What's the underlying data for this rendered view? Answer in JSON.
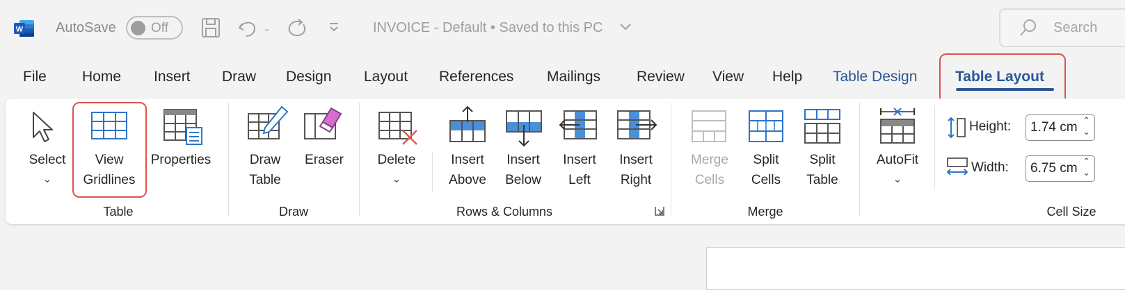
{
  "title_bar": {
    "autosave_label": "AutoSave",
    "autosave_state": "Off",
    "doc_title": "INVOICE - Default • Saved to this PC",
    "search_placeholder": "Search"
  },
  "tabs": [
    "File",
    "Home",
    "Insert",
    "Draw",
    "Design",
    "Layout",
    "References",
    "Mailings",
    "Review",
    "View",
    "Help",
    "Table Design",
    "Table Layout"
  ],
  "active_tab": "Table Layout",
  "ribbon": {
    "groups": {
      "table": "Table",
      "draw": "Draw",
      "rows_columns": "Rows & Columns",
      "merge": "Merge",
      "cell_size": "Cell Size"
    },
    "buttons": {
      "select": "Select",
      "view_gridlines_1": "View",
      "view_gridlines_2": "Gridlines",
      "properties": "Properties",
      "draw_table_1": "Draw",
      "draw_table_2": "Table",
      "eraser": "Eraser",
      "delete": "Delete",
      "insert_above_1": "Insert",
      "insert_above_2": "Above",
      "insert_below_1": "Insert",
      "insert_below_2": "Below",
      "insert_left_1": "Insert",
      "insert_left_2": "Left",
      "insert_right_1": "Insert",
      "insert_right_2": "Right",
      "merge_cells_1": "Merge",
      "merge_cells_2": "Cells",
      "split_cells_1": "Split",
      "split_cells_2": "Cells",
      "split_table_1": "Split",
      "split_table_2": "Table",
      "autofit": "AutoFit"
    },
    "cell_size": {
      "height_label": "Height:",
      "height_value": "1.74 cm",
      "width_label": "Width:",
      "width_value": "6.75 cm"
    }
  },
  "colors": {
    "accent": "#2b5797",
    "highlight": "#d9534f",
    "icon_blue": "#4a90d9"
  }
}
